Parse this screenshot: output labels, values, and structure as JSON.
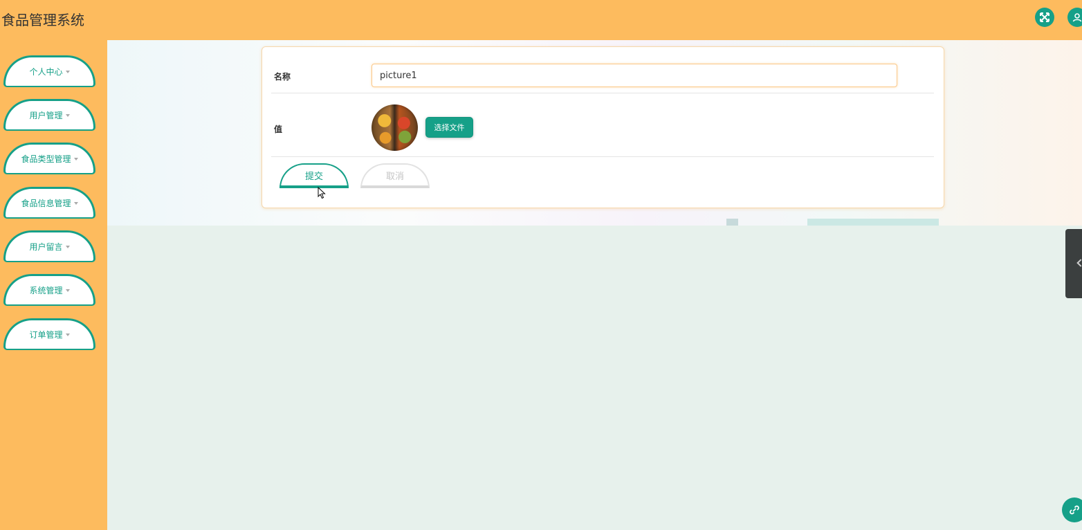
{
  "header": {
    "title": "食品管理系统",
    "fullscreen_icon": "expand-arrows-icon",
    "user_icon": "user-icon"
  },
  "sidebar": {
    "items": [
      {
        "label": "个人中心"
      },
      {
        "label": "用户管理"
      },
      {
        "label": "食品类型管理"
      },
      {
        "label": "食品信息管理"
      },
      {
        "label": "用户留言"
      },
      {
        "label": "系统管理"
      },
      {
        "label": "订单管理"
      }
    ]
  },
  "form": {
    "name_label": "名称",
    "name_value": "picture1",
    "value_label": "值",
    "file_button": "选择文件",
    "submit": "提交",
    "cancel": "取消"
  },
  "colors": {
    "header_bg": "#fdbb5e",
    "accent": "#16a088",
    "content_bg": "#e7f1ec"
  }
}
